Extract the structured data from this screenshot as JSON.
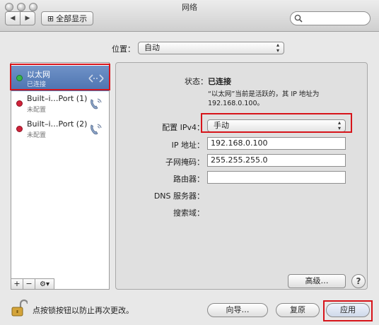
{
  "window": {
    "title": "网络"
  },
  "toolbar": {
    "back": "◀",
    "forward": "▶",
    "grid": "⊞",
    "show_all": "全部显示",
    "search_placeholder": ""
  },
  "location": {
    "label": "位置：",
    "value": "自动"
  },
  "services": [
    {
      "name": "以太网",
      "status": "已连接",
      "dot_color": "#39b54a",
      "icon": "ethernet-icon",
      "selected": true
    },
    {
      "name": "Built–i…Port (1)",
      "status": "未配置",
      "dot_color": "#d0233a",
      "icon": "phone-modem-icon",
      "selected": false
    },
    {
      "name": "Built–i…Port (2)",
      "status": "未配置",
      "dot_color": "#d0233a",
      "icon": "phone-modem-icon",
      "selected": false
    }
  ],
  "sidebar_buttons": {
    "add": "+",
    "remove": "−",
    "gear": "⚙▾"
  },
  "detail": {
    "status_label": "状态：",
    "status_value": "已连接",
    "status_desc_line1": "“以太网”当前是活跃的，其 IP 地址为",
    "status_desc_line2": "192.168.0.100。",
    "config_label": "配置 IPv4：",
    "config_value": "手动",
    "ip_label": "IP 地址：",
    "ip_value": "192.168.0.100",
    "mask_label": "子网掩码：",
    "mask_value": "255.255.255.0",
    "router_label": "路由器：",
    "router_value": "",
    "dns_label": "DNS 服务器：",
    "search_domain_label": "搜索域：",
    "advanced_button": "高级…",
    "help_button": "?"
  },
  "footer": {
    "lock_text": "点按锁按钮以防止再次更改。",
    "assist_button": "向导…",
    "revert_button": "复原",
    "apply_button": "应用"
  },
  "colors": {
    "highlight_box": "#d7141a",
    "selection": "#5a7fbd"
  }
}
